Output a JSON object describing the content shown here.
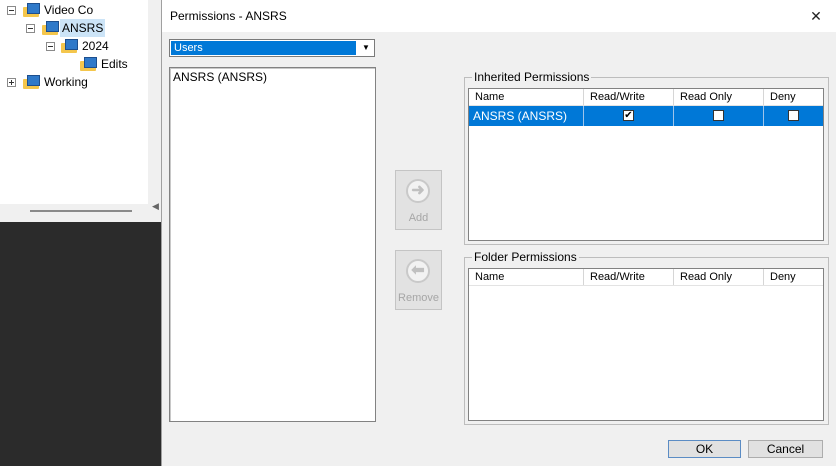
{
  "tree": {
    "items": [
      {
        "label": "Video Co",
        "expander": "minus",
        "icon": "folder-monitor-icon"
      },
      {
        "label": "ANSRS",
        "expander": "minus",
        "icon": "folder-monitor-icon",
        "selected": true
      },
      {
        "label": "2024",
        "expander": "minus",
        "icon": "folder-monitor-icon"
      },
      {
        "label": "Edits",
        "expander": "none",
        "icon": "folder-monitor-icon"
      },
      {
        "label": "Working",
        "expander": "plus",
        "icon": "folder-monitor-icon"
      }
    ],
    "scroll_left_glyph": "◀"
  },
  "dialog": {
    "title": "Permissions - ANSRS",
    "close_glyph": "✕",
    "type_select": {
      "value": "Users",
      "arrow_glyph": "▼"
    },
    "user_list": [
      "ANSRS (ANSRS)"
    ],
    "add_button": {
      "label": "Add",
      "glyph": "➜"
    },
    "remove_button": {
      "label": "Remove",
      "glyph": "⬅"
    },
    "inherited": {
      "title": "Inherited Permissions",
      "columns": [
        "Name",
        "Read/Write",
        "Read Only",
        "Deny"
      ],
      "rows": [
        {
          "name": "ANSRS (ANSRS)",
          "read_write": true,
          "read_only": false,
          "deny": false,
          "selected": true
        }
      ]
    },
    "folder": {
      "title": "Folder Permissions",
      "columns": [
        "Name",
        "Read/Write",
        "Read Only",
        "Deny"
      ],
      "rows": []
    },
    "ok_label": "OK",
    "cancel_label": "Cancel"
  },
  "colors": {
    "selection": "#0078d7",
    "tree_selection": "#cce4f7",
    "dialog_bg": "#f0f0f0",
    "background": "#2b2b2b"
  }
}
